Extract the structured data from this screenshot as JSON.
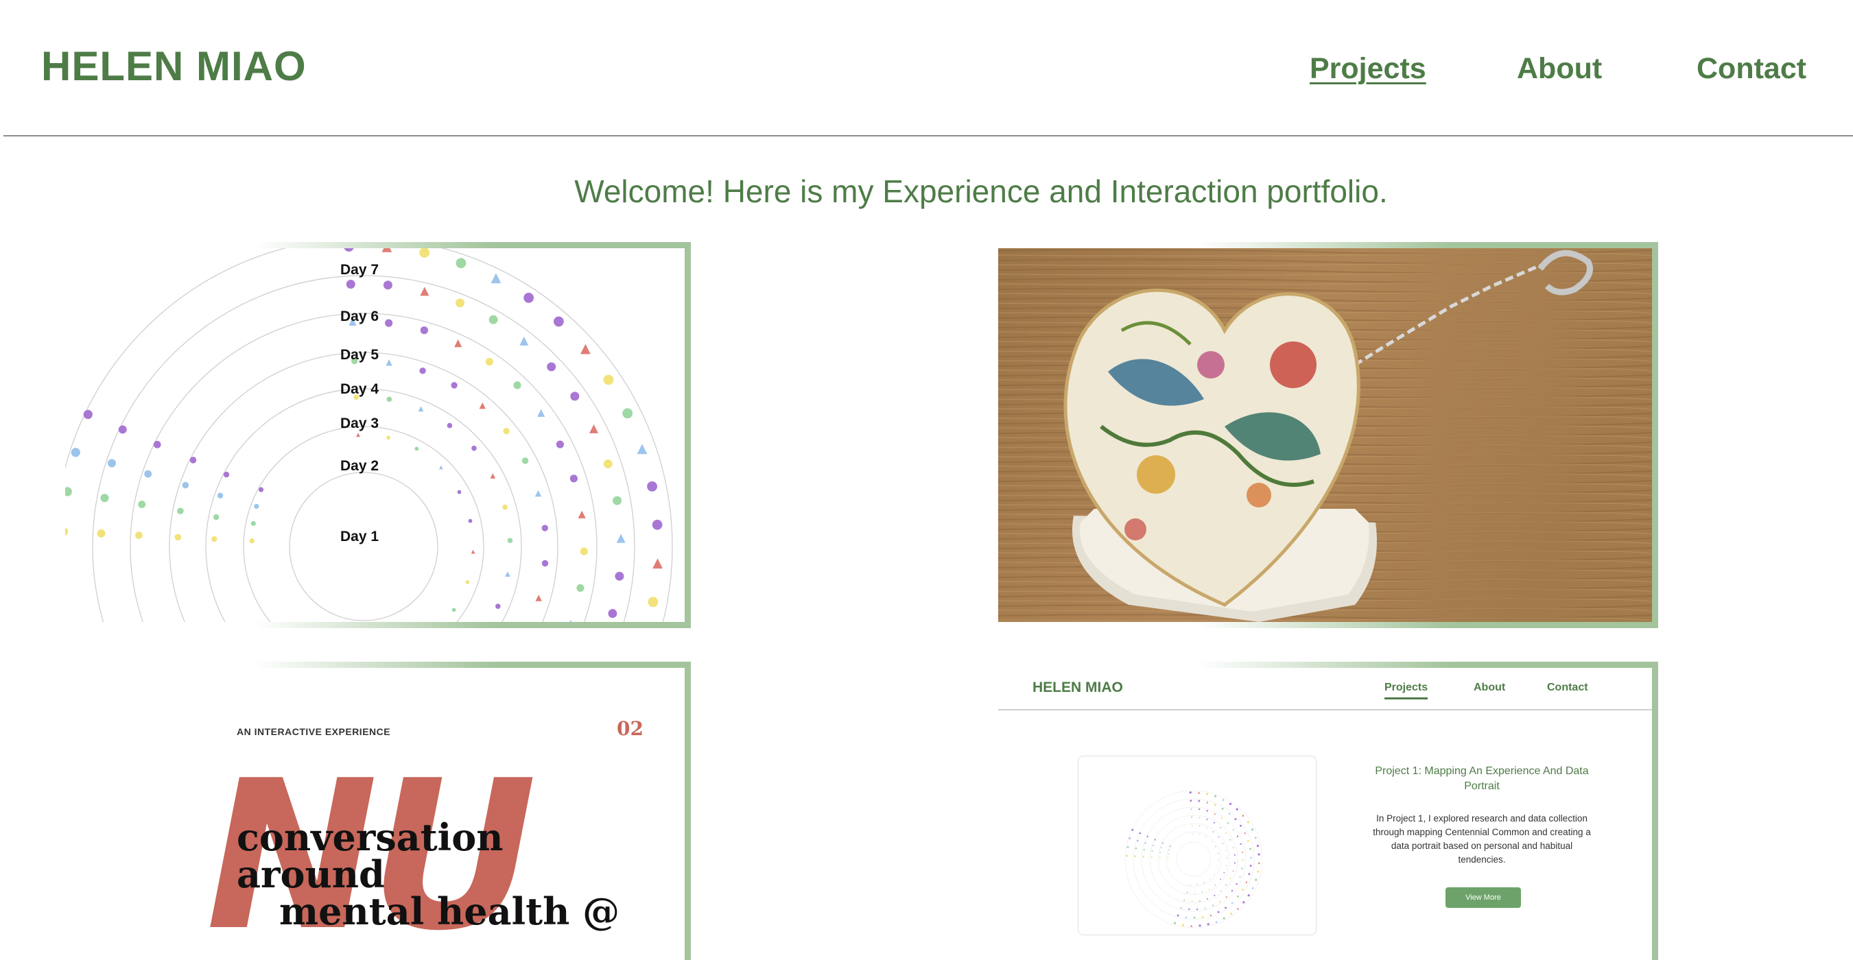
{
  "header": {
    "logo": "HELEN MIAO",
    "nav": [
      {
        "label": "Projects",
        "active": true
      },
      {
        "label": "About",
        "active": false
      },
      {
        "label": "Contact",
        "active": false
      }
    ]
  },
  "welcome": "Welcome! Here is my Experience and Interaction portfolio.",
  "colors": {
    "brand_green": "#4e7c47",
    "frame_green": "#a3c49c",
    "nu_red": "#c8675b"
  },
  "projects": [
    {
      "id": "data-portrait",
      "day_labels": [
        "Day 7",
        "Day 6",
        "Day 5",
        "Day 4",
        "Day 3",
        "Day 2",
        "Day 1"
      ]
    },
    {
      "id": "heart-box"
    },
    {
      "id": "nu-experience",
      "eyebrow": "AN INTERACTIVE EXPERIENCE",
      "number": "02",
      "big_letters": "NU",
      "headline_1": "conversation around",
      "headline_2": "mental health @"
    },
    {
      "id": "site-preview",
      "mini_logo": "HELEN MIAO",
      "mini_nav": [
        "Projects",
        "About",
        "Contact"
      ],
      "title": "Project 1: Mapping An Experience And Data Portrait",
      "body": "In Project 1, I explored research and data collection through mapping Centennial Common and creating a data portrait based on personal and habitual tendencies.",
      "button": "View More"
    }
  ]
}
